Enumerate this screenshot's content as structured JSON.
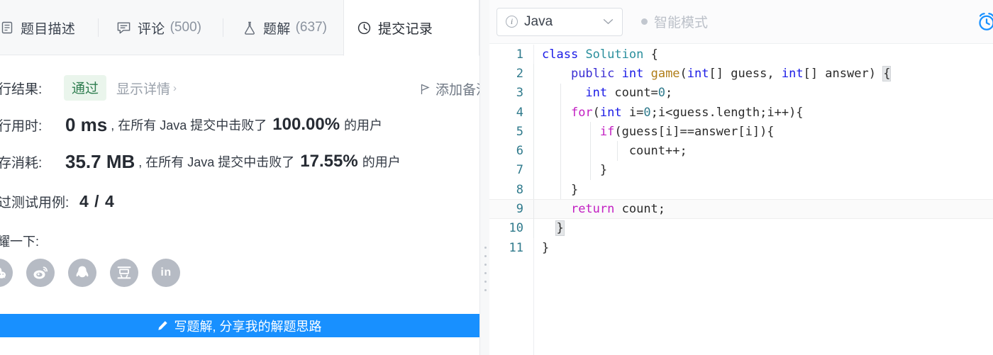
{
  "tabs": [
    {
      "label": "题目描述",
      "count": "",
      "icon": "document-icon",
      "active": false
    },
    {
      "label": "评论",
      "count": "(500)",
      "icon": "comment-icon",
      "active": false
    },
    {
      "label": "题解",
      "count": "(637)",
      "icon": "flask-icon",
      "active": false
    },
    {
      "label": "提交记录",
      "count": "",
      "icon": "clock-icon",
      "active": true
    }
  ],
  "result": {
    "exec_result_label": "执行结果:",
    "status_badge": "通过",
    "show_detail": "显示详情",
    "show_detail_chevron": "›",
    "add_note": "添加备注",
    "runtime_label": "执行用时:",
    "runtime_value": "0 ms",
    "runtime_mid": ", 在所有 Java 提交中击败了",
    "runtime_percent": "100.00%",
    "runtime_tail": "的用户",
    "memory_label": "内存消耗:",
    "memory_value": "35.7 MB",
    "memory_mid": ", 在所有 Java 提交中击败了",
    "memory_percent": "17.55%",
    "memory_tail": "的用户",
    "cases_label": "通过测试用例:",
    "cases_value": "4 / 4",
    "brag_label": "炫耀一下:",
    "social": [
      {
        "name": "wechat-icon",
        "letter": ""
      },
      {
        "name": "weibo-icon",
        "letter": ""
      },
      {
        "name": "qq-icon",
        "letter": ""
      },
      {
        "name": "douban-icon",
        "letter": ""
      },
      {
        "name": "linkedin-icon",
        "letter": "in"
      }
    ],
    "write_solution_button": "写题解, 分享我的解题思路"
  },
  "editor": {
    "language": "Java",
    "smart_mode": "智能模式",
    "timer_icon": "alarm-clock-icon",
    "accent_color": "#1890ff",
    "pass_color": "#2e7d4f",
    "lines": [
      {
        "n": "1",
        "current": false,
        "indents": [],
        "tokens": [
          {
            "t": "class",
            "c": "k-class"
          },
          {
            "t": " ",
            "c": "plain"
          },
          {
            "t": "Solution",
            "c": "id-class"
          },
          {
            "t": " {",
            "c": "plain"
          }
        ]
      },
      {
        "n": "2",
        "current": false,
        "indents": [
          62
        ],
        "tokens": [
          {
            "t": "    ",
            "c": "plain"
          },
          {
            "t": "public",
            "c": "k-mod"
          },
          {
            "t": " ",
            "c": "plain"
          },
          {
            "t": "int",
            "c": "k-type"
          },
          {
            "t": " ",
            "c": "plain"
          },
          {
            "t": "game",
            "c": "id-func"
          },
          {
            "t": "(",
            "c": "plain"
          },
          {
            "t": "int",
            "c": "k-type"
          },
          {
            "t": "[] guess, ",
            "c": "plain"
          },
          {
            "t": "int",
            "c": "k-type"
          },
          {
            "t": "[] answer) ",
            "c": "plain"
          },
          {
            "t": "{",
            "c": "plain brk"
          }
        ]
      },
      {
        "n": "3",
        "current": false,
        "indents": [
          62,
          100
        ],
        "tokens": [
          {
            "t": "      ",
            "c": "plain"
          },
          {
            "t": "int",
            "c": "k-type"
          },
          {
            "t": " count=",
            "c": "plain"
          },
          {
            "t": "0",
            "c": "num"
          },
          {
            "t": ";",
            "c": "plain"
          }
        ]
      },
      {
        "n": "4",
        "current": false,
        "indents": [
          62,
          100
        ],
        "tokens": [
          {
            "t": "    ",
            "c": "plain"
          },
          {
            "t": "for",
            "c": "k-flow"
          },
          {
            "t": "(",
            "c": "plain"
          },
          {
            "t": "int",
            "c": "k-type"
          },
          {
            "t": " i=",
            "c": "plain"
          },
          {
            "t": "0",
            "c": "num"
          },
          {
            "t": ";i<guess.length;i++){",
            "c": "plain"
          }
        ]
      },
      {
        "n": "5",
        "current": false,
        "indents": [
          62,
          100,
          142
        ],
        "tokens": [
          {
            "t": "        ",
            "c": "plain"
          },
          {
            "t": "if",
            "c": "k-flow"
          },
          {
            "t": "(guess[i]==answer[i]){",
            "c": "plain"
          }
        ]
      },
      {
        "n": "6",
        "current": false,
        "indents": [
          62,
          100,
          142,
          180
        ],
        "tokens": [
          {
            "t": "            count++;",
            "c": "plain"
          }
        ]
      },
      {
        "n": "7",
        "current": false,
        "indents": [
          62,
          100,
          142
        ],
        "tokens": [
          {
            "t": "        }",
            "c": "plain"
          }
        ]
      },
      {
        "n": "8",
        "current": false,
        "indents": [
          62,
          100
        ],
        "tokens": [
          {
            "t": "    }",
            "c": "plain"
          }
        ]
      },
      {
        "n": "9",
        "current": true,
        "indents": [
          62
        ],
        "tokens": [
          {
            "t": "    ",
            "c": "plain"
          },
          {
            "t": "return",
            "c": "k-ret"
          },
          {
            "t": " count;",
            "c": "plain"
          }
        ]
      },
      {
        "n": "10",
        "current": false,
        "indents": [
          62
        ],
        "tokens": [
          {
            "t": "  ",
            "c": "plain"
          },
          {
            "t": "}",
            "c": "plain brk"
          }
        ]
      },
      {
        "n": "11",
        "current": false,
        "indents": [],
        "tokens": [
          {
            "t": "}",
            "c": "plain"
          }
        ]
      }
    ]
  }
}
